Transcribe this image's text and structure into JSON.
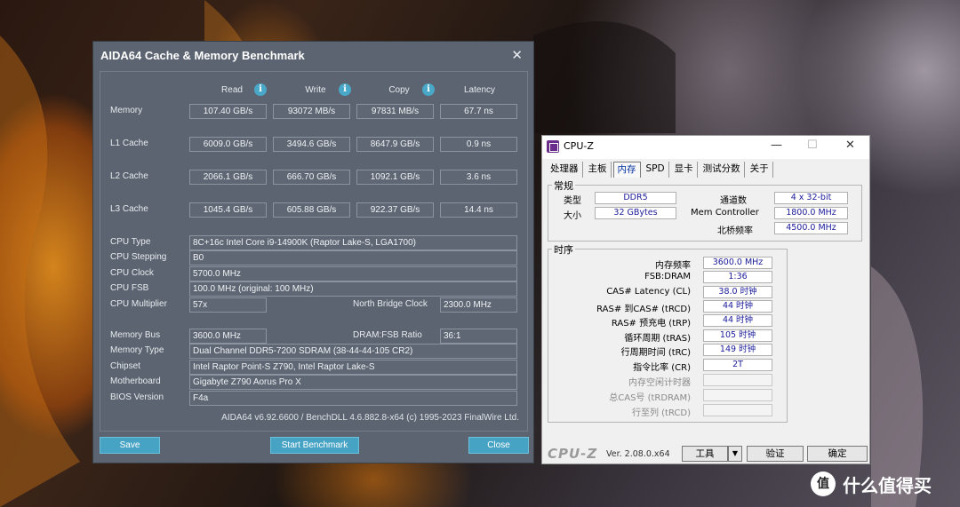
{
  "aida": {
    "title": "AIDA64 Cache & Memory Benchmark",
    "close_glyph": "✕",
    "columns": [
      "Read",
      "Write",
      "Copy",
      "Latency"
    ],
    "info_glyph": "i",
    "rows": [
      {
        "label": "Memory",
        "read": "107.40 GB/s",
        "write": "93072 MB/s",
        "copy": "97831 MB/s",
        "latency": "67.7 ns"
      },
      {
        "label": "L1 Cache",
        "read": "6009.0 GB/s",
        "write": "3494.6 GB/s",
        "copy": "8647.9 GB/s",
        "latency": "0.9 ns"
      },
      {
        "label": "L2 Cache",
        "read": "2066.1 GB/s",
        "write": "666.70 GB/s",
        "copy": "1092.1 GB/s",
        "latency": "3.6 ns"
      },
      {
        "label": "L3 Cache",
        "read": "1045.4 GB/s",
        "write": "605.88 GB/s",
        "copy": "922.37 GB/s",
        "latency": "14.4 ns"
      }
    ],
    "cpu": {
      "type_label": "CPU Type",
      "type": "8C+16c Intel Core i9-14900K  (Raptor Lake-S, LGA1700)",
      "stepping_label": "CPU Stepping",
      "stepping": "B0",
      "clock_label": "CPU Clock",
      "clock": "5700.0 MHz",
      "fsb_label": "CPU FSB",
      "fsb": "100.0 MHz  (original: 100 MHz)",
      "multiplier_label": "CPU Multiplier",
      "multiplier": "57x",
      "nb_clock_label": "North Bridge Clock",
      "nb_clock": "2300.0 MHz"
    },
    "mem": {
      "bus_label": "Memory Bus",
      "bus": "3600.0 MHz",
      "ratio_label": "DRAM:FSB Ratio",
      "ratio": "36:1",
      "type_label": "Memory Type",
      "type": "Dual Channel DDR5-7200 SDRAM  (38-44-44-105 CR2)",
      "chipset_label": "Chipset",
      "chipset": "Intel Raptor Point-S Z790, Intel Raptor Lake-S",
      "motherboard_label": "Motherboard",
      "motherboard": "Gigabyte Z790 Aorus Pro X",
      "bios_label": "BIOS Version",
      "bios": "F4a"
    },
    "footer": "AIDA64 v6.92.6600 / BenchDLL 4.6.882.8-x64  (c) 1995-2023 FinalWire Ltd.",
    "buttons": {
      "save": "Save",
      "start": "Start Benchmark",
      "close": "Close"
    }
  },
  "cpuz": {
    "title": "CPU-Z",
    "min_glyph": "—",
    "max_glyph": "☐",
    "close_glyph": "✕",
    "tabs": [
      "处理器",
      "主板",
      "内存",
      "SPD",
      "显卡",
      "测试分数",
      "关于"
    ],
    "active_tab": "内存",
    "general": {
      "title": "常规",
      "type_label": "类型",
      "type": "DDR5",
      "size_label": "大小",
      "size": "32 GBytes",
      "channels_label": "通道数",
      "channels": "4 x 32-bit",
      "mem_ctrl_label": "Mem Controller",
      "mem_ctrl": "1800.0 MHz",
      "nb_freq_label": "北桥频率",
      "nb_freq": "4500.0 MHz"
    },
    "timings": {
      "title": "时序",
      "rows": [
        {
          "label": "内存频率",
          "value": "3600.0 MHz"
        },
        {
          "label": "FSB:DRAM",
          "value": "1:36"
        },
        {
          "label": "CAS# Latency (CL)",
          "value": "38.0 时钟"
        },
        {
          "label": "RAS# 到CAS# (tRCD)",
          "value": "44 时钟"
        },
        {
          "label": "RAS# 预充电 (tRP)",
          "value": "44 时钟"
        },
        {
          "label": "循环周期 (tRAS)",
          "value": "105 时钟"
        },
        {
          "label": "行周期时间 (tRC)",
          "value": "149 时钟"
        },
        {
          "label": "指令比率 (CR)",
          "value": "2T"
        },
        {
          "label": "内存空闲计时器",
          "value": ""
        },
        {
          "label": "总CAS号 (tRDRAM)",
          "value": ""
        },
        {
          "label": "行至列 (tRCD)",
          "value": ""
        }
      ]
    },
    "logo": "CPU-Z",
    "version": "Ver. 2.08.0.x64",
    "tools_label": "工具",
    "dropdown_glyph": "▼",
    "validate_label": "验证",
    "ok_label": "确定"
  },
  "watermark": {
    "logo": "值",
    "text": "什么值得买"
  }
}
